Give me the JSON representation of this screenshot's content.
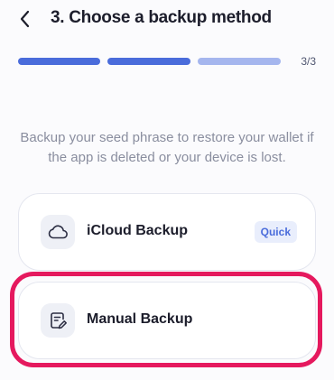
{
  "header": {
    "title": "3. Choose a backup method",
    "back_icon": "chevron-left-icon"
  },
  "progress": {
    "step_label": "3/3",
    "segments": [
      {
        "state": "complete",
        "color": "#4a6cdb"
      },
      {
        "state": "complete",
        "color": "#4a6cdb"
      },
      {
        "state": "current",
        "color": "#a5b6ee"
      }
    ]
  },
  "description": "Backup your seed phrase to restore your wallet if the app is deleted or your device is lost.",
  "options": [
    {
      "label": "iCloud Backup",
      "icon": "cloud-icon",
      "badge": "Quick"
    },
    {
      "label": "Manual Backup",
      "icon": "edit-document-icon",
      "highlighted": true,
      "highlight_color": "#e5195e"
    }
  ]
}
